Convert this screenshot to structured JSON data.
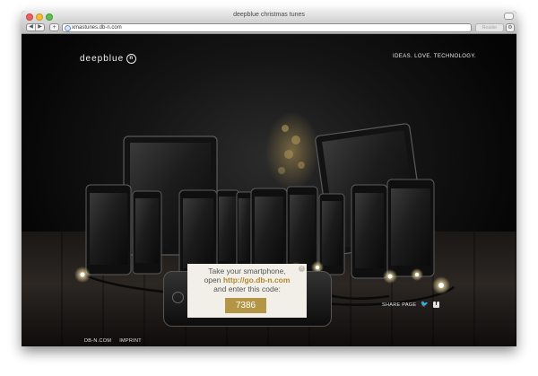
{
  "browser": {
    "window_title": "deepblue christmas tunes",
    "url": "xmastunes.db-n.com",
    "back_symbol": "◀",
    "forward_symbol": "▶",
    "add_symbol": "+",
    "reader_label": "Reader",
    "settings_symbol": "⚙"
  },
  "page": {
    "logo_text": "deepblue",
    "logo_mark": "n",
    "tagline": "IDEAS. LOVE. TECHNOLOGY.",
    "card": {
      "line1": "Take your smartphone,",
      "line2_prefix": "open ",
      "link": "http://go.db-n.com",
      "line3": "and enter this code:",
      "code": "7386",
      "close_symbol": "×"
    },
    "footer": {
      "links": [
        "DB-N.COM",
        "IMPRINT"
      ],
      "share_label": "SHARE PAGE",
      "twitter_glyph": "🐦",
      "facebook_glyph": "f"
    }
  },
  "colors": {
    "accent": "#b49545",
    "link": "#b0882f",
    "background": "#000000"
  },
  "icons": [
    "back-arrow-icon",
    "forward-arrow-icon",
    "add-tab-icon",
    "globe-icon",
    "gear-icon",
    "close-icon",
    "twitter-icon",
    "facebook-icon"
  ]
}
